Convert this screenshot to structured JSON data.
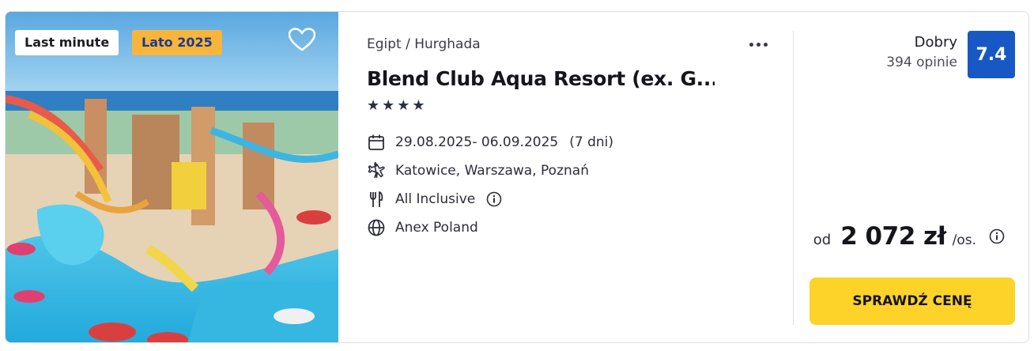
{
  "photo": {
    "alt": "Aquapark hotelowy z basenami i zjeżdżalniami",
    "badges": [
      "Last minute",
      "Lato 2025"
    ],
    "favorite_icon": "heart-outline-icon"
  },
  "offer": {
    "destination": "Egipt / Hurghada",
    "menu_icon": "more-dots-icon",
    "hotel_name": "Blend Club Aqua Resort (ex. G...",
    "stars": 4,
    "dates": "29.08.2025- 06.09.2025",
    "duration": "(7 dni)",
    "departures": "Katowice, Warszawa, Poznań",
    "board": "All Inclusive",
    "operator": "Anex Poland"
  },
  "rating": {
    "label": "Dobry",
    "reviews": "394 opinie",
    "score": "7.4"
  },
  "price": {
    "prefix": "od",
    "amount": "2 072 zł",
    "suffix": "/os."
  },
  "cta": {
    "label": "SPRAWDŹ CENĘ"
  },
  "colors": {
    "score_bg": "#1758c4",
    "cta_bg": "#fdd32a",
    "season_badge_bg": "#f7b53c"
  }
}
